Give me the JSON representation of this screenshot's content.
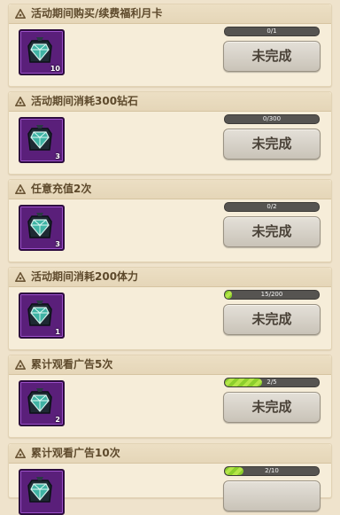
{
  "tasks": [
    {
      "title": "活动期间购买/续费福利月卡",
      "item_count": "10",
      "progress_text": "0/1",
      "progress": 0,
      "button_label": "未完成"
    },
    {
      "title": "活动期间消耗300钻石",
      "item_count": "3",
      "progress_text": "0/300",
      "progress": 0,
      "button_label": "未完成"
    },
    {
      "title": "任意充值2次",
      "item_count": "3",
      "progress_text": "0/2",
      "progress": 0,
      "button_label": "未完成"
    },
    {
      "title": "活动期间消耗200体力",
      "item_count": "1",
      "progress_text": "15/200",
      "progress": 0.075,
      "button_label": "未完成"
    },
    {
      "title": "累计观看广告5次",
      "item_count": "2",
      "progress_text": "2/5",
      "progress": 0.4,
      "button_label": "未完成"
    },
    {
      "title": "累计观看广告10次",
      "item_count": "",
      "progress_text": "2/10",
      "progress": 0.2,
      "button_label": ""
    }
  ],
  "colors": {
    "panel": "#efe3cc",
    "progress_fill": "#8ccf2c",
    "item_frame": "#5a1f7a"
  },
  "icons": {
    "header": "recycle-triangle-icon",
    "reward": "teal-gem-pouch-icon"
  }
}
